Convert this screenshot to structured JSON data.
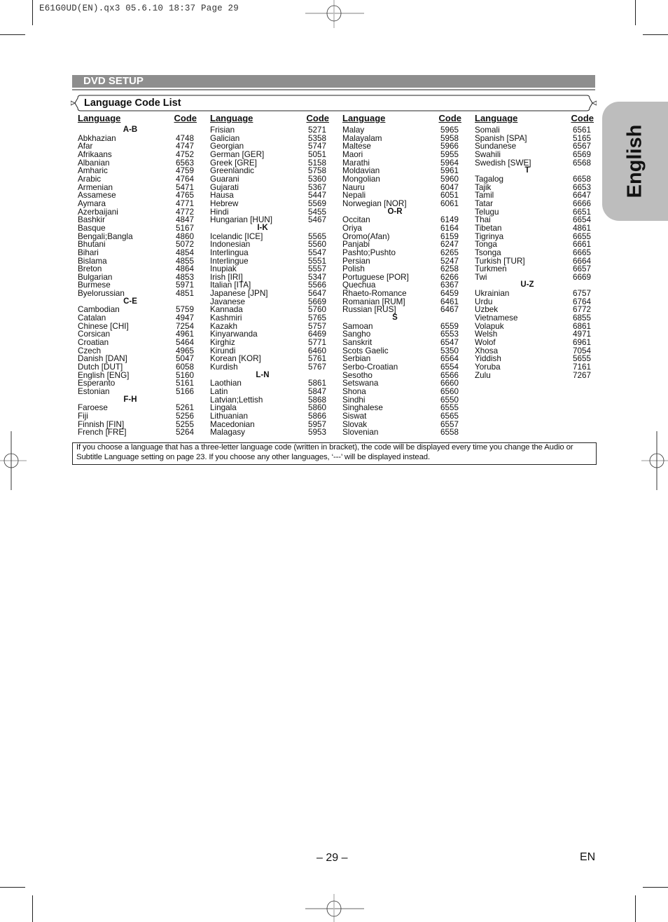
{
  "slug_line": "E61G0UD(EN).qx3  05.6.10 18:37  Page 29",
  "header": {
    "title": "DVD SETUP"
  },
  "section": {
    "title": "Language Code List"
  },
  "column_headers": {
    "language": "Language",
    "code": "Code"
  },
  "columns": [
    [
      {
        "group": "A-B"
      },
      {
        "lang": "Abkhazian",
        "code": "4748"
      },
      {
        "lang": "Afar",
        "code": "4747"
      },
      {
        "lang": "Afrikaans",
        "code": "4752"
      },
      {
        "lang": "Albanian",
        "code": "6563"
      },
      {
        "lang": "Amharic",
        "code": "4759"
      },
      {
        "lang": "Arabic",
        "code": "4764"
      },
      {
        "lang": "Armenian",
        "code": "5471"
      },
      {
        "lang": "Assamese",
        "code": "4765"
      },
      {
        "lang": "Aymara",
        "code": "4771"
      },
      {
        "lang": "Azerbaijani",
        "code": "4772"
      },
      {
        "lang": "Bashkir",
        "code": "4847"
      },
      {
        "lang": "Basque",
        "code": "5167"
      },
      {
        "lang": "Bengali;Bangla",
        "code": "4860"
      },
      {
        "lang": "Bhutani",
        "code": "5072"
      },
      {
        "lang": "Bihari",
        "code": "4854"
      },
      {
        "lang": "Bislama",
        "code": "4855"
      },
      {
        "lang": "Breton",
        "code": "4864"
      },
      {
        "lang": "Bulgarian",
        "code": "4853"
      },
      {
        "lang": "Burmese",
        "code": "5971"
      },
      {
        "lang": "Byelorussian",
        "code": "4851"
      },
      {
        "group": "C-E"
      },
      {
        "lang": "Cambodian",
        "code": "5759"
      },
      {
        "lang": "Catalan",
        "code": "4947"
      },
      {
        "lang": "Chinese [CHI]",
        "code": "7254"
      },
      {
        "lang": "Corsican",
        "code": "4961"
      },
      {
        "lang": "Croatian",
        "code": "5464"
      },
      {
        "lang": "Czech",
        "code": "4965"
      },
      {
        "lang": "Danish [DAN]",
        "code": "5047"
      },
      {
        "lang": "Dutch [DUT]",
        "code": "6058"
      },
      {
        "lang": "English [ENG]",
        "code": "5160"
      },
      {
        "lang": "Esperanto",
        "code": "5161"
      },
      {
        "lang": "Estonian",
        "code": "5166"
      },
      {
        "group": "F-H"
      },
      {
        "lang": "Faroese",
        "code": "5261"
      },
      {
        "lang": "Fiji",
        "code": "5256"
      },
      {
        "lang": "Finnish [FIN]",
        "code": "5255"
      },
      {
        "lang": "French [FRE]",
        "code": "5264"
      }
    ],
    [
      {
        "lang": "Frisian",
        "code": "5271"
      },
      {
        "lang": "Galician",
        "code": "5358"
      },
      {
        "lang": "Georgian",
        "code": "5747"
      },
      {
        "lang": "German [GER]",
        "code": "5051"
      },
      {
        "lang": "Greek [GRE]",
        "code": "5158"
      },
      {
        "lang": "Greenlandic",
        "code": "5758"
      },
      {
        "lang": "Guarani",
        "code": "5360"
      },
      {
        "lang": "Gujarati",
        "code": "5367"
      },
      {
        "lang": "Hausa",
        "code": "5447"
      },
      {
        "lang": "Hebrew",
        "code": "5569"
      },
      {
        "lang": "Hindi",
        "code": "5455"
      },
      {
        "lang": "Hungarian [HUN]",
        "code": "5467"
      },
      {
        "group": "I-K"
      },
      {
        "lang": "Icelandic [ICE]",
        "code": "5565"
      },
      {
        "lang": "Indonesian",
        "code": "5560"
      },
      {
        "lang": "Interlingua",
        "code": "5547"
      },
      {
        "lang": "Interlingue",
        "code": "5551"
      },
      {
        "lang": "Inupiak",
        "code": "5557"
      },
      {
        "lang": "Irish [IRI]",
        "code": "5347"
      },
      {
        "lang": "Italian [ITA]",
        "code": "5566"
      },
      {
        "lang": "Japanese [JPN]",
        "code": "5647"
      },
      {
        "lang": "Javanese",
        "code": "5669"
      },
      {
        "lang": "Kannada",
        "code": "5760"
      },
      {
        "lang": "Kashmiri",
        "code": "5765"
      },
      {
        "lang": "Kazakh",
        "code": "5757"
      },
      {
        "lang": "Kinyarwanda",
        "code": "6469"
      },
      {
        "lang": "Kirghiz",
        "code": "5771"
      },
      {
        "lang": "Kirundi",
        "code": "6460"
      },
      {
        "lang": "Korean [KOR]",
        "code": "5761"
      },
      {
        "lang": "Kurdish",
        "code": "5767"
      },
      {
        "group": "L-N"
      },
      {
        "lang": "Laothian",
        "code": "5861"
      },
      {
        "lang": "Latin",
        "code": "5847"
      },
      {
        "lang": "Latvian;Lettish",
        "code": "5868"
      },
      {
        "lang": "Lingala",
        "code": "5860"
      },
      {
        "lang": "Lithuanian",
        "code": "5866"
      },
      {
        "lang": "Macedonian",
        "code": "5957"
      },
      {
        "lang": "Malagasy",
        "code": "5953"
      }
    ],
    [
      {
        "lang": "Malay",
        "code": "5965"
      },
      {
        "lang": "Malayalam",
        "code": "5958"
      },
      {
        "lang": "Maltese",
        "code": "5966"
      },
      {
        "lang": "Maori",
        "code": "5955"
      },
      {
        "lang": "Marathi",
        "code": "5964"
      },
      {
        "lang": "Moldavian",
        "code": "5961"
      },
      {
        "lang": "Mongolian",
        "code": "5960"
      },
      {
        "lang": "Nauru",
        "code": "6047"
      },
      {
        "lang": "Nepali",
        "code": "6051"
      },
      {
        "lang": "Norwegian [NOR]",
        "code": "6061"
      },
      {
        "group": "O-R"
      },
      {
        "lang": "Occitan",
        "code": "6149"
      },
      {
        "lang": "Oriya",
        "code": "6164"
      },
      {
        "lang": "Oromo(Afan)",
        "code": "6159"
      },
      {
        "lang": "Panjabi",
        "code": "6247"
      },
      {
        "lang": "Pashto;Pushto",
        "code": "6265"
      },
      {
        "lang": "Persian",
        "code": "5247"
      },
      {
        "lang": "Polish",
        "code": "6258"
      },
      {
        "lang": "Portuguese [POR]",
        "code": "6266"
      },
      {
        "lang": "Quechua",
        "code": "6367"
      },
      {
        "lang": "Rhaeto-Romance",
        "code": "6459"
      },
      {
        "lang": "Romanian [RUM]",
        "code": "6461"
      },
      {
        "lang": "Russian [RUS]",
        "code": "6467"
      },
      {
        "group": "S"
      },
      {
        "lang": "Samoan",
        "code": "6559"
      },
      {
        "lang": "Sangho",
        "code": "6553"
      },
      {
        "lang": "Sanskrit",
        "code": "6547"
      },
      {
        "lang": "Scots Gaelic",
        "code": "5350"
      },
      {
        "lang": "Serbian",
        "code": "6564"
      },
      {
        "lang": "Serbo-Croatian",
        "code": "6554"
      },
      {
        "lang": "Sesotho",
        "code": "6566"
      },
      {
        "lang": "Setswana",
        "code": "6660"
      },
      {
        "lang": "Shona",
        "code": "6560"
      },
      {
        "lang": "Sindhi",
        "code": "6550"
      },
      {
        "lang": "Singhalese",
        "code": "6555"
      },
      {
        "lang": "Siswat",
        "code": "6565"
      },
      {
        "lang": "Slovak",
        "code": "6557"
      },
      {
        "lang": "Slovenian",
        "code": "6558"
      }
    ],
    [
      {
        "lang": "Somali",
        "code": "6561"
      },
      {
        "lang": "Spanish [SPA]",
        "code": "5165"
      },
      {
        "lang": "Sundanese",
        "code": "6567"
      },
      {
        "lang": "Swahili",
        "code": "6569"
      },
      {
        "lang": "Swedish [SWE]",
        "code": "6568"
      },
      {
        "group": "T"
      },
      {
        "lang": "Tagalog",
        "code": "6658"
      },
      {
        "lang": "Tajik",
        "code": "6653"
      },
      {
        "lang": "Tamil",
        "code": "6647"
      },
      {
        "lang": "Tatar",
        "code": "6666"
      },
      {
        "lang": "Telugu",
        "code": "6651"
      },
      {
        "lang": "Thai",
        "code": "6654"
      },
      {
        "lang": "Tibetan",
        "code": "4861"
      },
      {
        "lang": "Tigrinya",
        "code": "6655"
      },
      {
        "lang": "Tonga",
        "code": "6661"
      },
      {
        "lang": "Tsonga",
        "code": "6665"
      },
      {
        "lang": "Turkish [TUR]",
        "code": "6664"
      },
      {
        "lang": "Turkmen",
        "code": "6657"
      },
      {
        "lang": "Twi",
        "code": "6669"
      },
      {
        "group": "U-Z"
      },
      {
        "lang": "Ukrainian",
        "code": "6757"
      },
      {
        "lang": "Urdu",
        "code": "6764"
      },
      {
        "lang": "Uzbek",
        "code": "6772"
      },
      {
        "lang": "Vietnamese",
        "code": "6855"
      },
      {
        "lang": "Volapuk",
        "code": "6861"
      },
      {
        "lang": "Welsh",
        "code": "4971"
      },
      {
        "lang": "Wolof",
        "code": "6961"
      },
      {
        "lang": "Xhosa",
        "code": "7054"
      },
      {
        "lang": "Yiddish",
        "code": "5655"
      },
      {
        "lang": "Yoruba",
        "code": "7161"
      },
      {
        "lang": "Zulu",
        "code": "7267"
      }
    ]
  ],
  "note": "If you choose a language that has a three-letter language code (written in bracket), the code will be displayed every time you change the Audio or Subtitle Language setting on page 23. If you choose any other languages, ‘---’ will be displayed instead.",
  "side_tab": {
    "label": "English"
  },
  "footer": {
    "page_number": "– 29 –",
    "language_code": "EN"
  },
  "colors": {
    "header_bar": "#8e8e8e",
    "side_tab": "#bdbdbd"
  }
}
